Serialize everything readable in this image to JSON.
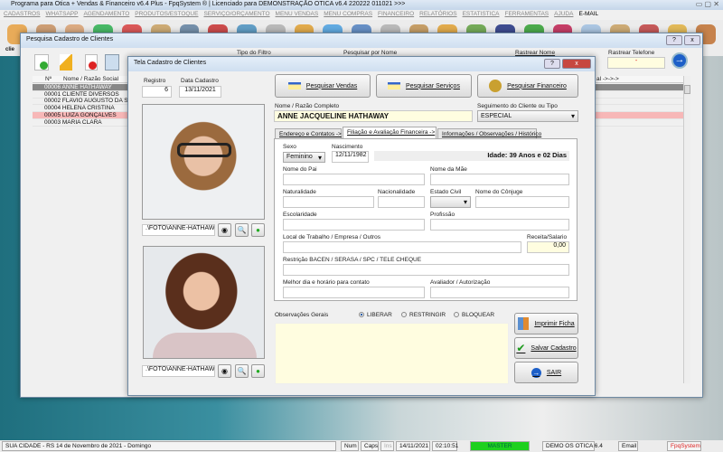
{
  "app": {
    "title": "Programa para Otica + Vendas & Financeiro v6.4 Plus - FpqSystem ® | Licenciado para  DEMONSTRAÇÃO OTICA v6.4 220222 011021 >>>",
    "menu": [
      "CADASTROS",
      "WHATSAPP",
      "AGENDAMENTO",
      "PRODUTOS/ESTOQUE",
      "SERVIÇO/ORÇAMENTO",
      "MENU VENDAS",
      "MENU COMPRAS",
      "FINANCEIRO",
      "RELATÓRIOS",
      "ESTATISTICA",
      "FERRAMENTAS",
      "AJUDA"
    ],
    "email_menu": "E-MAIL",
    "toolbar_first_label": "clie"
  },
  "search_window": {
    "title": "Pesquisa Cadastro de Clientes",
    "filter_type_label": "Tipo do Filtro",
    "search_name_label": "Pesquisar por Nome",
    "track_name_label": "Rastrear Nome",
    "track_phone_label": "Rastrear Telefone",
    "track_phone_value": "-",
    "columns": {
      "num": "Nº",
      "name": "Nome / Razão Social",
      "partial": "al ->->->"
    },
    "rows": [
      {
        "num": "00006",
        "name": "ANNE HATHAWAY"
      },
      {
        "num": "00001",
        "name": "CLIENTE DIVERSOS"
      },
      {
        "num": "00002",
        "name": "FLAVIO AUGUSTO DA SILVA"
      },
      {
        "num": "00004",
        "name": "HELENA CRISTINA"
      },
      {
        "num": "00005",
        "name": "LUIZA GONÇALVES"
      },
      {
        "num": "00003",
        "name": "MARIA CLARA"
      }
    ]
  },
  "dialog": {
    "title": "Tela Cadastro de Clientes",
    "help": "?",
    "close": "x",
    "registro_label": "Registro",
    "registro": "6",
    "data_cadastro_label": "Data Cadastro",
    "data_cadastro": "13/11/2021",
    "photo_path_1": ".\\FOTO\\ANNE-HATHAWAY-0",
    "photo_path_2": ".\\FOTO\\ANNE-HATHAWAY-0",
    "btn_vendas": "Pesquisar Vendas",
    "btn_servicos": "Pesquisar Serviços",
    "btn_financeiro": "Pesquisar  Financeiro",
    "nome_label": "Nome / Razão Completo",
    "nome": "ANNE JACQUELINE HATHAWAY",
    "seguimento_label": "Seguimento do Cliente ou Tipo",
    "seguimento": "ESPECIAL",
    "tabs": [
      "Endereço e Contatos ->",
      "Filiação e Avaliação Financeira ->",
      "Informações / Observações / Histórico"
    ],
    "sexo_label": "Sexo",
    "sexo": "Feminino",
    "nascimento_label": "Nascimento",
    "nascimento": "12/11/1982",
    "idade": "Idade: 39 Anos  e 02 Dias",
    "pai_label": "Nome do Pai",
    "mae_label": "Nome da Mãe",
    "naturalidade_label": "Naturalidade",
    "nacionalidade_label": "Nacionalidade",
    "estado_civil_label": "Estado Civil",
    "conjuge_label": "Nome do Cônjuge",
    "escolaridade_label": "Escolaridade",
    "profissao_label": "Profissão",
    "trabalho_label": "Local de Trabalho / Empresa / Outros",
    "receita_label": "Receita/Salario",
    "receita": "0,00",
    "restricao_label": "Restrição BACEN / SERASA / SPC / TELE CHEQUE",
    "melhor_dia_label": "Melhor dia e horário para contato",
    "avaliador_label": "Avaliador / Autorização",
    "obs_label": "Observações Gerais",
    "radio_liberar": "LIBERAR",
    "radio_restringir": "RESTRINGIR",
    "radio_bloquear": "BLOQUEAR",
    "btn_imprimir": "Imprimir Ficha",
    "btn_salvar": "Salvar Cadastro",
    "btn_sair": "SAIR"
  },
  "status": {
    "city_date": "SUA CIDADE - RS 14 de Novembro de 2021 - Domingo",
    "num": "Num",
    "caps": "Caps",
    "ins": "Ins",
    "date": "14/11/2021",
    "time": "02:10:51",
    "user": "MASTER",
    "demo": "DEMO OS OTICA 6.4",
    "email": "Email",
    "brand": "FpqSystem"
  }
}
